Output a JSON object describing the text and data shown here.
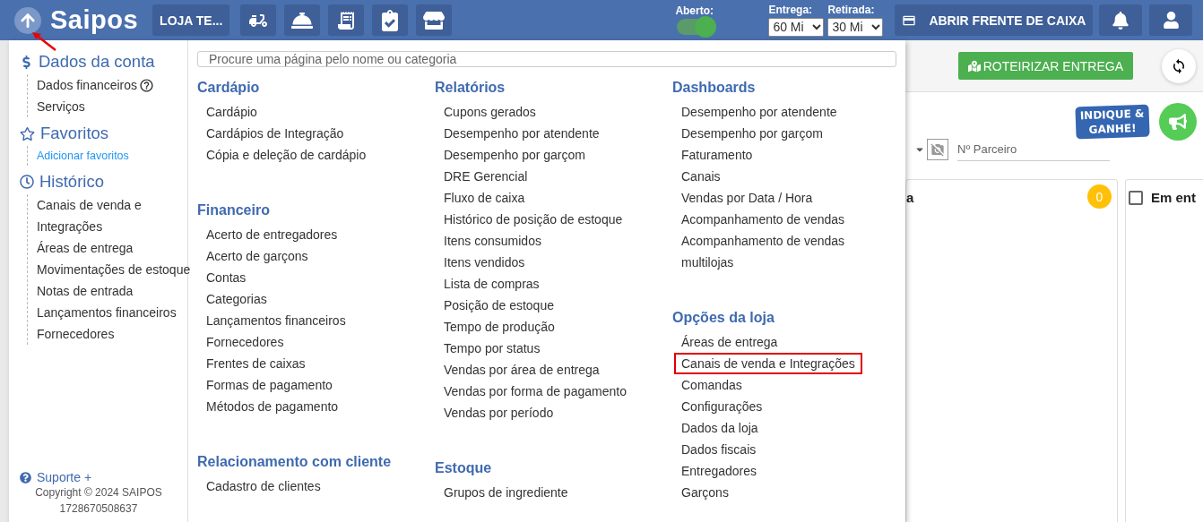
{
  "navbar": {
    "logo_text": "Saipos",
    "store_button": "LOJA TE...",
    "open_toggle": {
      "label": "Aberto:",
      "on": true
    },
    "selects": [
      {
        "label": "Entrega:",
        "value": "60 Mi"
      },
      {
        "label": "Retirada:",
        "value": "30 Mi"
      }
    ],
    "cash_button": "ABRIR FRENTE DE CAIXA"
  },
  "sidebar": {
    "sections": [
      {
        "kind": "account",
        "title": "Dados da conta",
        "items": [
          {
            "kind": "item",
            "label": "Dados financeiros",
            "help": true
          },
          {
            "kind": "item",
            "label": "Serviços",
            "help": false
          }
        ]
      },
      {
        "kind": "favorites",
        "title": "Favoritos",
        "items": [
          {
            "kind": "link",
            "label": "Adicionar favoritos"
          }
        ]
      },
      {
        "kind": "history",
        "title": "Histórico",
        "items": [
          {
            "kind": "item",
            "label": "Canais de venda e Integrações",
            "help": false
          },
          {
            "kind": "item",
            "label": "Áreas de entrega",
            "help": false
          },
          {
            "kind": "item",
            "label": "Movimentações de estoque",
            "help": false
          },
          {
            "kind": "item",
            "label": "Notas de entrada",
            "help": false
          },
          {
            "kind": "item",
            "label": "Lançamentos financeiros",
            "help": false
          },
          {
            "kind": "item",
            "label": "Fornecedores",
            "help": false
          }
        ]
      }
    ],
    "footer": {
      "support": "Suporte +",
      "copyright": "Copyright © 2024 SAIPOS",
      "build": "1728670508637"
    }
  },
  "menu": {
    "search": {
      "placeholder": "Procure uma página pelo nome ou categoria"
    },
    "columns": [
      [
        {
          "title": "Cardápio",
          "items": [
            {
              "label": "Cardápio",
              "highlighted": false
            },
            {
              "label": "Cardápios de Integração",
              "highlighted": false
            },
            {
              "label": "Cópia e deleção de cardápio",
              "highlighted": false
            }
          ]
        },
        {
          "title": "Financeiro",
          "items": [
            {
              "label": "Acerto de entregadores",
              "highlighted": false
            },
            {
              "label": "Acerto de garçons",
              "highlighted": false
            },
            {
              "label": "Contas",
              "highlighted": false
            },
            {
              "label": "Categorias",
              "highlighted": false
            },
            {
              "label": "Lançamentos financeiros",
              "highlighted": false
            },
            {
              "label": "Fornecedores",
              "highlighted": false
            },
            {
              "label": "Frentes de caixas",
              "highlighted": false
            },
            {
              "label": "Formas de pagamento",
              "highlighted": false
            },
            {
              "label": "Métodos de pagamento",
              "highlighted": false
            }
          ]
        },
        {
          "title": "Relacionamento com cliente",
          "items": [
            {
              "label": "Cadastro de clientes",
              "highlighted": false
            }
          ]
        }
      ],
      [
        {
          "title": "Relatórios",
          "items": [
            {
              "label": "Cupons gerados",
              "highlighted": false
            },
            {
              "label": "Desempenho por atendente",
              "highlighted": false
            },
            {
              "label": "Desempenho por garçom",
              "highlighted": false
            },
            {
              "label": "DRE Gerencial",
              "highlighted": false
            },
            {
              "label": "Fluxo de caixa",
              "highlighted": false
            },
            {
              "label": "Histórico de posição de estoque",
              "highlighted": false
            },
            {
              "label": "Itens consumidos",
              "highlighted": false
            },
            {
              "label": "Itens vendidos",
              "highlighted": false
            },
            {
              "label": "Lista de compras",
              "highlighted": false
            },
            {
              "label": "Posição de estoque",
              "highlighted": false
            },
            {
              "label": "Tempo de produção",
              "highlighted": false
            },
            {
              "label": "Tempo por status",
              "highlighted": false
            },
            {
              "label": "Vendas por área de entrega",
              "highlighted": false
            },
            {
              "label": "Vendas por forma de pagamento",
              "highlighted": false
            },
            {
              "label": "Vendas por período",
              "highlighted": false
            }
          ]
        },
        {
          "title": "Estoque",
          "items": [
            {
              "label": "Grupos de ingrediente",
              "highlighted": false
            }
          ]
        }
      ],
      [
        {
          "title": "Dashboards",
          "items": [
            {
              "label": "Desempenho por atendente",
              "highlighted": false
            },
            {
              "label": "Desempenho por garçom",
              "highlighted": false
            },
            {
              "label": "Faturamento",
              "highlighted": false
            },
            {
              "label": "Canais",
              "highlighted": false
            },
            {
              "label": "Vendas por Data / Hora",
              "highlighted": false
            },
            {
              "label": "Acompanhamento de vendas",
              "highlighted": false
            },
            {
              "label": "Acompanhamento de vendas multilojas",
              "highlighted": false
            }
          ]
        },
        {
          "title": "Opções da loja",
          "items": [
            {
              "label": "Áreas de entrega",
              "highlighted": false
            },
            {
              "label": "Canais de venda e Integrações",
              "highlighted": true
            },
            {
              "label": "Comandas",
              "highlighted": false
            },
            {
              "label": "Configurações",
              "highlighted": false
            },
            {
              "label": "Dados da loja",
              "highlighted": false
            },
            {
              "label": "Dados fiscais",
              "highlighted": false
            },
            {
              "label": "Entregadores",
              "highlighted": false
            },
            {
              "label": "Garçons",
              "highlighted": false
            }
          ]
        }
      ]
    ]
  },
  "page": {
    "route_button": "ROTEIRIZAR ENTREGA",
    "referral": [
      "INDIQUE &",
      "GANHE!"
    ],
    "partner": {
      "placeholder": "Nº Parceiro"
    },
    "cards": [
      {
        "kind": "count",
        "title": "a",
        "count": "0"
      },
      {
        "kind": "check",
        "title": "Em ent",
        "checked": false
      }
    ]
  }
}
